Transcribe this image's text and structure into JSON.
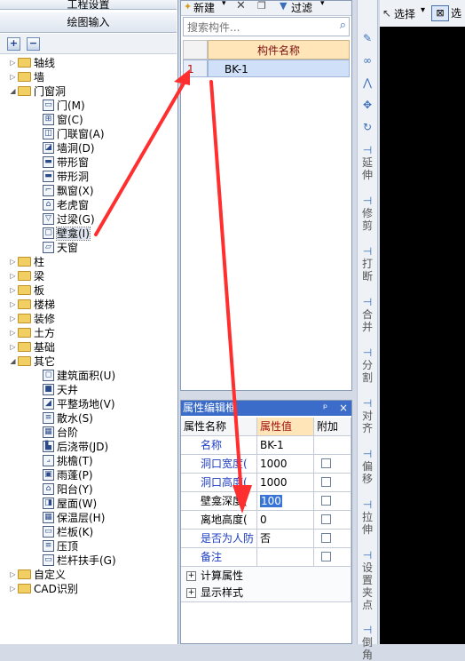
{
  "left_panel": {
    "top_tab1": "工程设置",
    "top_tab2": "绘图输入",
    "tree": [
      {
        "label": "轴线",
        "type": "folder",
        "expanded": false
      },
      {
        "label": "墙",
        "type": "folder",
        "expanded": false
      },
      {
        "label": "门窗洞",
        "type": "folder",
        "expanded": true
      },
      {
        "label": "门(M)",
        "type": "item"
      },
      {
        "label": "窗(C)",
        "type": "item"
      },
      {
        "label": "门联窗(A)",
        "type": "item"
      },
      {
        "label": "墙洞(D)",
        "type": "item"
      },
      {
        "label": "带形窗",
        "type": "item"
      },
      {
        "label": "带形洞",
        "type": "item"
      },
      {
        "label": "飘窗(X)",
        "type": "item"
      },
      {
        "label": "老虎窗",
        "type": "item"
      },
      {
        "label": "过梁(G)",
        "type": "item"
      },
      {
        "label": "壁龛(I)",
        "type": "item",
        "selected": true
      },
      {
        "label": "天窗",
        "type": "item"
      },
      {
        "label": "柱",
        "type": "folder",
        "expanded": false
      },
      {
        "label": "梁",
        "type": "folder",
        "expanded": false
      },
      {
        "label": "板",
        "type": "folder",
        "expanded": false
      },
      {
        "label": "楼梯",
        "type": "folder",
        "expanded": false
      },
      {
        "label": "装修",
        "type": "folder",
        "expanded": false
      },
      {
        "label": "土方",
        "type": "folder",
        "expanded": false
      },
      {
        "label": "基础",
        "type": "folder",
        "expanded": false
      },
      {
        "label": "其它",
        "type": "folder",
        "expanded": true
      },
      {
        "label": "建筑面积(U)",
        "type": "item"
      },
      {
        "label": "天井",
        "type": "item"
      },
      {
        "label": "平整场地(V)",
        "type": "item"
      },
      {
        "label": "散水(S)",
        "type": "item"
      },
      {
        "label": "台阶",
        "type": "item"
      },
      {
        "label": "后浇带(JD)",
        "type": "item"
      },
      {
        "label": "挑檐(T)",
        "type": "item"
      },
      {
        "label": "雨蓬(P)",
        "type": "item"
      },
      {
        "label": "阳台(Y)",
        "type": "item"
      },
      {
        "label": "屋面(W)",
        "type": "item"
      },
      {
        "label": "保温层(H)",
        "type": "item"
      },
      {
        "label": "栏板(K)",
        "type": "item"
      },
      {
        "label": "压顶",
        "type": "item"
      },
      {
        "label": "栏杆扶手(G)",
        "type": "item"
      },
      {
        "label": "自定义",
        "type": "folder",
        "expanded": false
      },
      {
        "label": "CAD识别",
        "type": "folder",
        "expanded": false
      }
    ]
  },
  "component_list": {
    "new_label": "新建",
    "filter_label": "过滤",
    "search_placeholder": "搜索构件...",
    "column_header": "构件名称",
    "rows": [
      {
        "index": "1",
        "name": "BK-1"
      }
    ]
  },
  "properties": {
    "title": "属性编辑框",
    "pin_icon": "ᵖ",
    "close_icon": "×",
    "headers": {
      "name": "属性名称",
      "value": "属性值",
      "extra": "附加"
    },
    "rows": [
      {
        "name": "名称",
        "value": "BK-1",
        "checkbox": false,
        "blue": true
      },
      {
        "name": "洞口宽度(",
        "value": "1000",
        "checkbox": true,
        "blue": true
      },
      {
        "name": "洞口高度(",
        "value": "1000",
        "checkbox": true,
        "blue": true
      },
      {
        "name": "壁龛深度(",
        "value": "100",
        "checkbox": true,
        "blue": false,
        "editing": true
      },
      {
        "name": "离地高度(",
        "value": "0",
        "checkbox": true,
        "blue": false
      },
      {
        "name": "是否为人防",
        "value": "否",
        "checkbox": true,
        "blue": true
      },
      {
        "name": "备注",
        "value": "",
        "checkbox": true,
        "blue": true
      }
    ],
    "groups": [
      "计算属性",
      "显示样式"
    ]
  },
  "right_toolbar": {
    "items": [
      "延伸",
      "修剪",
      "打断",
      "合并",
      "分割",
      "对齐",
      "偏移",
      "拉伸",
      "设置夹点",
      "倒角"
    ]
  },
  "top_toolbar": {
    "select_label": "选择"
  }
}
